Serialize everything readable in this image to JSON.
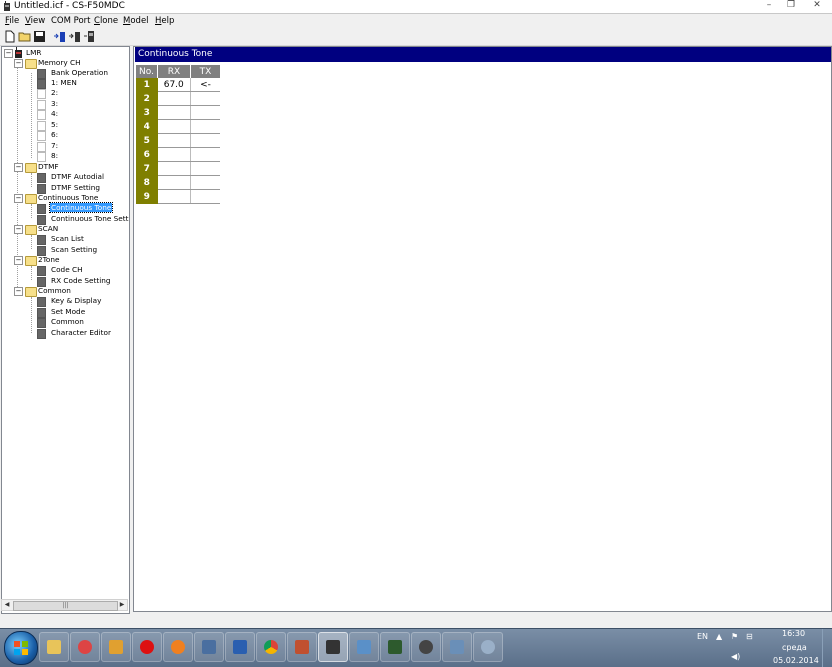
{
  "window": {
    "title": "Untitled.icf - CS-F50MDC"
  },
  "menu": [
    {
      "label": "File",
      "accel": "F",
      "rest": "ile"
    },
    {
      "label": "View",
      "accel": "V",
      "rest": "iew"
    },
    {
      "label": "COM Port",
      "accel": "",
      "rest": "COM Port"
    },
    {
      "label": "Clone",
      "accel": "C",
      "rest": "lone"
    },
    {
      "label": "Model",
      "accel": "M",
      "rest": "odel"
    },
    {
      "label": "Help",
      "accel": "H",
      "rest": "elp"
    }
  ],
  "toolbar": {
    "icons": [
      "new-file-icon",
      "open-folder-icon",
      "save-icon",
      "read-from-radio-icon",
      "write-to-radio-icon",
      "model-info-icon"
    ]
  },
  "tree": {
    "root": "LMR",
    "memory_ch": "Memory CH",
    "bank_operation": "Bank Operation",
    "ch1": "1: MEN",
    "ch2": "2:",
    "ch3": "3:",
    "ch4": "4:",
    "ch5": "5:",
    "ch6": "6:",
    "ch7": "7:",
    "ch8": "8:",
    "dtmf": "DTMF",
    "dtmf_autodial": "DTMF Autodial",
    "dtmf_setting": "DTMF Setting",
    "continuous_tone": "Continuous Tone",
    "continuous_tone_item": "Continuous Tone",
    "continuous_tone_setting": "Continuous Tone Setting",
    "scan": "SCAN",
    "scan_list": "Scan List",
    "scan_setting": "Scan Setting",
    "two_tone": "2Tone",
    "code_ch": "Code CH",
    "rx_code_setting": "RX Code Setting",
    "common": "Common",
    "key_display": "Key & Display",
    "set_mode": "Set Mode",
    "common_item": "Common",
    "character_editor": "Character Editor"
  },
  "panel": {
    "title": "Continuous Tone",
    "columns": {
      "no": "No.",
      "rx": "RX",
      "tx": "TX"
    },
    "rows": [
      {
        "no": "1",
        "rx": "67.0",
        "tx": "<-"
      },
      {
        "no": "2",
        "rx": "",
        "tx": ""
      },
      {
        "no": "3",
        "rx": "",
        "tx": ""
      },
      {
        "no": "4",
        "rx": "",
        "tx": ""
      },
      {
        "no": "5",
        "rx": "",
        "tx": ""
      },
      {
        "no": "6",
        "rx": "",
        "tx": ""
      },
      {
        "no": "7",
        "rx": "",
        "tx": ""
      },
      {
        "no": "8",
        "rx": "",
        "tx": ""
      },
      {
        "no": "9",
        "rx": "",
        "tx": ""
      }
    ]
  },
  "taskbar": {
    "lang": "EN",
    "time": "16:30",
    "day": "среда",
    "date": "05.02.2014",
    "apps": [
      "explorer-icon",
      "media-player-icon",
      "tool-icon",
      "opera-icon",
      "firefox-icon",
      "network-icon",
      "word-icon",
      "chrome-icon",
      "archive-icon",
      "radio-programmer-icon",
      "monitor-icon",
      "terminal-icon",
      "headset-icon",
      "remote-icon",
      "speedometer-icon"
    ]
  },
  "colors": {
    "panel_header": "#000080",
    "num_cell": "#7f7f00",
    "col_header": "#808080",
    "selection": "#3399ff"
  }
}
